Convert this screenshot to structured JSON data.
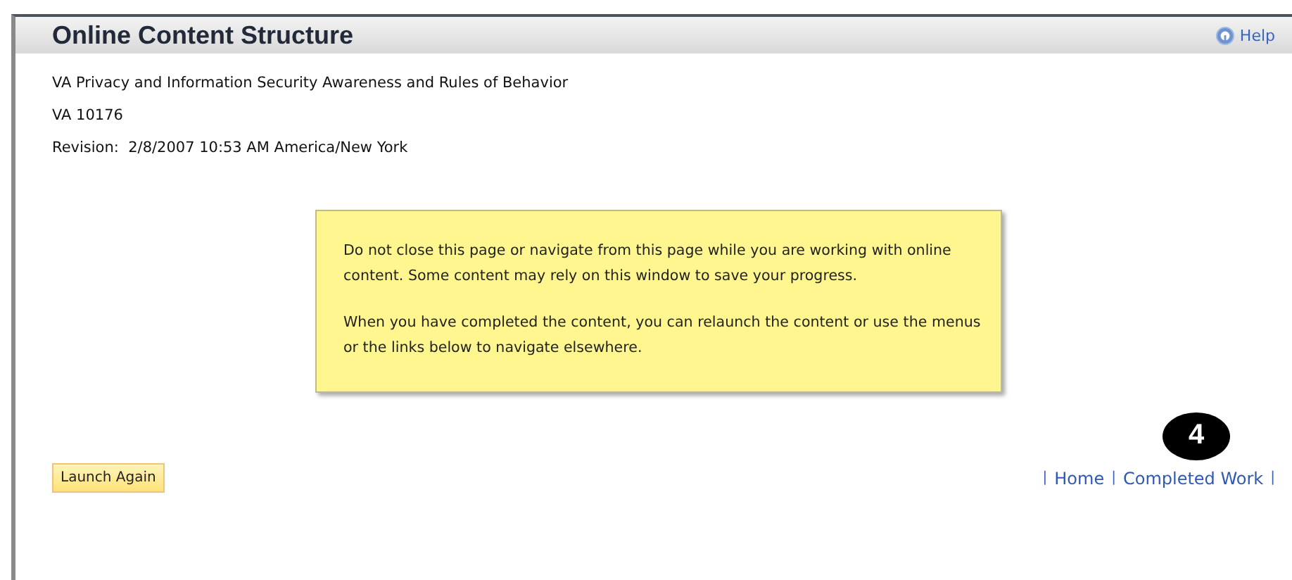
{
  "header": {
    "title": "Online Content Structure",
    "help": "Help"
  },
  "details": [
    "VA Privacy and Information Security Awareness and Rules of Behavior",
    "VA 10176",
    "Revision:  2/8/2007 10:53 AM America/New York"
  ],
  "notice": [
    "Do not close this page or navigate from this page while you are working with online content. Some content may rely on this window to save your progress.",
    "When you have completed the content, you can relaunch the content or use the menus or the links below to navigate elsewhere."
  ],
  "launch_button": "Launch Again",
  "callout_badge": "4",
  "link_separator": "|",
  "links": [
    "Home",
    "Completed Work"
  ]
}
